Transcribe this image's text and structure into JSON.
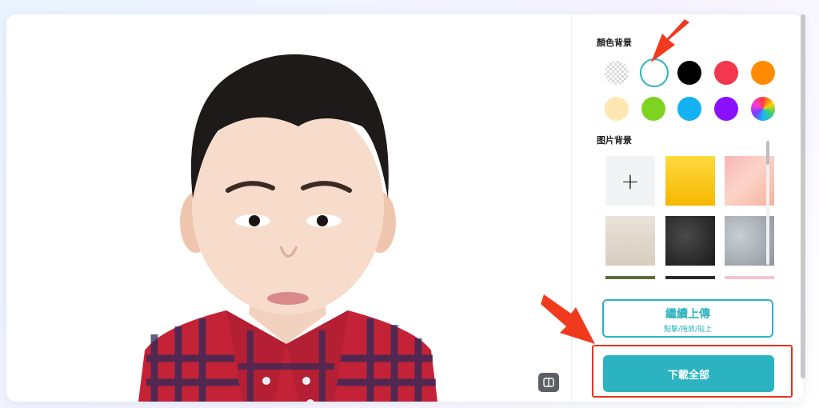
{
  "panel": {
    "color_bg_title": "顏色背景",
    "image_bg_title": "图片背景",
    "swatches": [
      {
        "name": "transparent",
        "color": ""
      },
      {
        "name": "white",
        "color": "#ffffff",
        "selected": true
      },
      {
        "name": "black",
        "color": "#000000"
      },
      {
        "name": "red",
        "color": "#f3374f"
      },
      {
        "name": "orange",
        "color": "#ff8c00"
      },
      {
        "name": "cream",
        "color": "#fde7b2"
      },
      {
        "name": "green",
        "color": "#7ed321"
      },
      {
        "name": "sky-blue",
        "color": "#13b2f2"
      },
      {
        "name": "purple",
        "color": "#8a10ff"
      },
      {
        "name": "rainbow",
        "color": "gradient"
      }
    ],
    "image_tiles": [
      "add",
      "yellow",
      "pink-peach",
      "beige-paper",
      "dark-concrete",
      "grey-concrete",
      "green-leaves",
      "dark-stripe",
      "pink-stripe"
    ],
    "add_icon": "+"
  },
  "buttons": {
    "continue_label": "繼續上傳",
    "continue_sub": "點擊/拖放/貼上",
    "download_label": "下載全部"
  },
  "colors": {
    "accent": "#2bb3c1",
    "highlight": "#e8321f"
  },
  "icons": {
    "compare": "compare-split-icon"
  }
}
